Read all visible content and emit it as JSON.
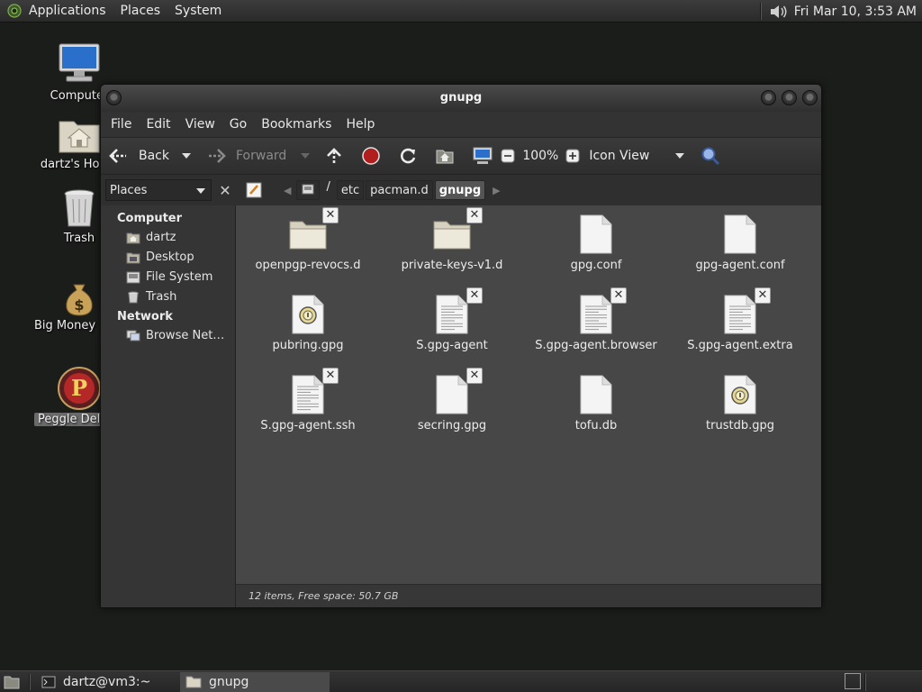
{
  "top_panel": {
    "menus": [
      "Applications",
      "Places",
      "System"
    ],
    "clock": "Fri Mar 10,  3:53 AM"
  },
  "desktop_icons": [
    {
      "label": "Computer",
      "icon": "computer-icon"
    },
    {
      "label": "dartz's Home",
      "icon": "home-folder-icon"
    },
    {
      "label": "Trash",
      "icon": "trash-icon"
    },
    {
      "label": "Big Money Deluxe",
      "icon": "money-bag-icon"
    },
    {
      "label": "Peggle Deluxe",
      "icon": "peggle-icon",
      "selected": true
    }
  ],
  "window": {
    "title": "gnupg",
    "menubar": [
      "File",
      "Edit",
      "View",
      "Go",
      "Bookmarks",
      "Help"
    ],
    "toolbar": {
      "back": "Back",
      "forward": "Forward",
      "zoom": "100%",
      "view_mode": "Icon View"
    },
    "places_combo": "Places",
    "path": [
      "/",
      "etc",
      "pacman.d",
      "gnupg"
    ],
    "sidebar": {
      "computer_header": "Computer",
      "computer_items": [
        "dartz",
        "Desktop",
        "File System",
        "Trash"
      ],
      "network_header": "Network",
      "network_items": [
        "Browse Net…"
      ]
    },
    "files": [
      {
        "name": "openpgp-revocs.d",
        "type": "folder",
        "locked": true
      },
      {
        "name": "private-keys-v1.d",
        "type": "folder",
        "locked": true
      },
      {
        "name": "gpg.conf",
        "type": "doc-blank",
        "locked": false
      },
      {
        "name": "gpg-agent.conf",
        "type": "doc-blank",
        "locked": false
      },
      {
        "name": "pubring.gpg",
        "type": "key",
        "locked": false
      },
      {
        "name": "S.gpg-agent",
        "type": "doc-lines",
        "locked": true
      },
      {
        "name": "S.gpg-agent.browser",
        "type": "doc-lines",
        "locked": true
      },
      {
        "name": "S.gpg-agent.extra",
        "type": "doc-lines",
        "locked": true
      },
      {
        "name": "S.gpg-agent.ssh",
        "type": "doc-lines",
        "locked": true
      },
      {
        "name": "secring.gpg",
        "type": "doc-blank",
        "locked": true
      },
      {
        "name": "tofu.db",
        "type": "doc-blank",
        "locked": false
      },
      {
        "name": "trustdb.gpg",
        "type": "key",
        "locked": false
      }
    ],
    "status": "12 items, Free space: 50.7 GB"
  },
  "bottom_panel": {
    "tasks": [
      "dartz@vm3:~",
      "gnupg"
    ]
  },
  "colors": {
    "desktop": "#1b1d1b",
    "window_content": "#474747",
    "sidebar": "#353535"
  }
}
